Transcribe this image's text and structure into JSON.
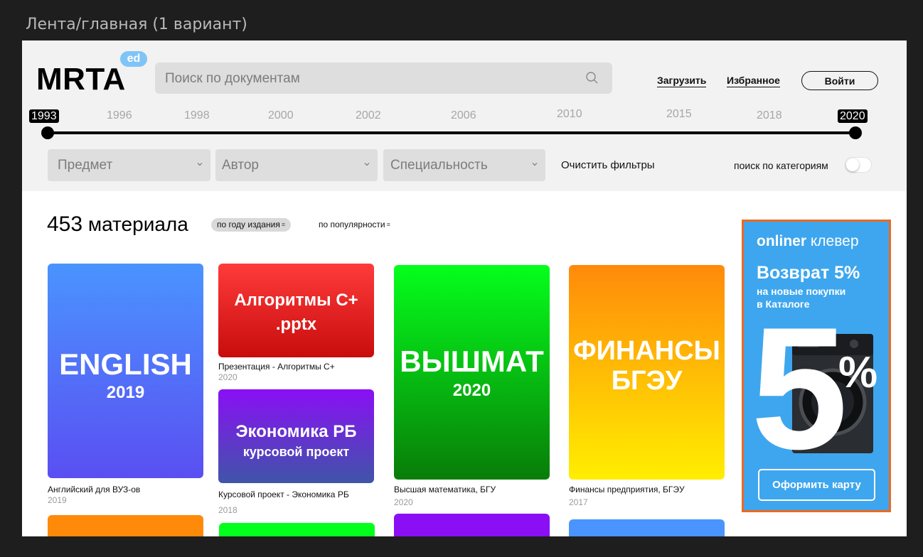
{
  "frame_title": "Лента/главная (1 вариант)",
  "logo": {
    "text": "MRTA",
    "badge": "ed"
  },
  "search": {
    "placeholder": "Поиск по документам"
  },
  "nav": {
    "upload": "Загрузить",
    "favorites": "Избранное",
    "login": "Войти"
  },
  "timeline": {
    "years": [
      "1993",
      "1996",
      "1998",
      "2000",
      "2002",
      "2006",
      "2010",
      "2015",
      "2018",
      "2020"
    ],
    "selected_start": "1993",
    "selected_end": "2020"
  },
  "filters": {
    "subject": "Предмет",
    "author": "Автор",
    "specialty": "Специальность",
    "clear": "Очистить фильтры",
    "category_search": "поиск по категориям",
    "category_search_enabled": false
  },
  "results": {
    "count": "453",
    "count_label": "материала",
    "sort_year": "по году издания",
    "sort_popularity": "по популярности"
  },
  "cards": [
    {
      "cover_title": "ENGLISH",
      "cover_subtitle": "2019",
      "caption": "Английский для ВУЗ-ов",
      "year": "2019",
      "colors": [
        "#4a94ff",
        "#5a4ff2"
      ]
    },
    {
      "cover_title": "Алгоритмы С+",
      "cover_subtitle": ".pptx",
      "caption": "Презентация - Алгоритмы С+",
      "year": "2020",
      "colors": [
        "#ff3b3b",
        "#c80c0c"
      ]
    },
    {
      "cover_title": "Экономика РБ",
      "cover_subtitle": "курсовой проект",
      "caption": "Курсовой проект - Экономика РБ",
      "year": "2018",
      "colors": [
        "#8a0ff5",
        "#3f55a8"
      ]
    },
    {
      "cover_title": "ВЫШМАТ",
      "cover_subtitle": "2020",
      "caption": "Высшая математика, БГУ",
      "year": "2020",
      "colors": [
        "#05ff1c",
        "#087d08"
      ]
    },
    {
      "cover_title": "ФИНАНСЫ",
      "cover_subtitle": "БГЭУ",
      "caption": "Финансы предприятия, БГЭУ",
      "year": "2017",
      "colors": [
        "#ff8a0a",
        "#ffee00"
      ]
    }
  ],
  "ad": {
    "brand": "onliner",
    "brand_suffix": "клевер",
    "headline": "Возврат 5%",
    "subline_1": "на новые покупки",
    "subline_2": "в Каталоге",
    "big_number": "5",
    "percent": "%",
    "cta": "Оформить карту",
    "bg_color": "#3ea6ee",
    "border_color": "#ea6a22"
  }
}
